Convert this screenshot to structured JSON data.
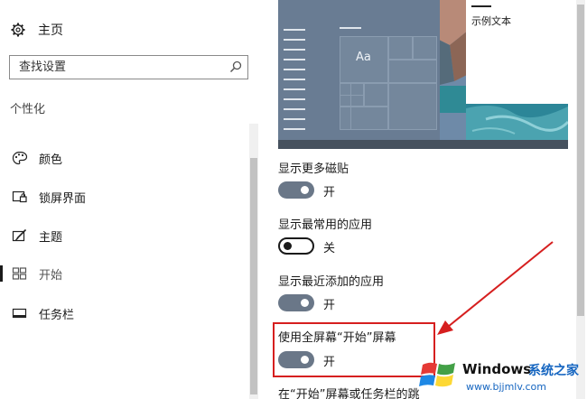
{
  "sidebar": {
    "home_label": "主页",
    "search_placeholder": "查找设置",
    "section_title": "个性化",
    "items": [
      {
        "label": "颜色",
        "icon": "palette-icon"
      },
      {
        "label": "锁屏界面",
        "icon": "lock-screen-icon"
      },
      {
        "label": "主题",
        "icon": "theme-brush-icon"
      },
      {
        "label": "开始",
        "icon": "start-tiles-icon",
        "selected": true
      },
      {
        "label": "任务栏",
        "icon": "taskbar-icon"
      }
    ]
  },
  "preview": {
    "tile_text": "Aa",
    "sample_text": "示例文本"
  },
  "settings": [
    {
      "label": "显示更多磁贴",
      "state": "开",
      "on": true
    },
    {
      "label": "显示最常用的应用",
      "state": "关",
      "on": false
    },
    {
      "label": "显示最近添加的应用",
      "state": "开",
      "on": true
    },
    {
      "label": "使用全屏幕“开始”屏幕",
      "state": "开",
      "on": true
    },
    {
      "label": "在“开始”屏幕或任务栏的跳"
    }
  ],
  "annotation": {
    "color": "#d61f1f"
  },
  "watermark": {
    "brand": "Windows",
    "brand_cn": "系统之家",
    "url": "www.bjjmlv.com"
  },
  "colors": {
    "toggle_on": "#6a7788",
    "watermark_blue": "#1565c0"
  }
}
